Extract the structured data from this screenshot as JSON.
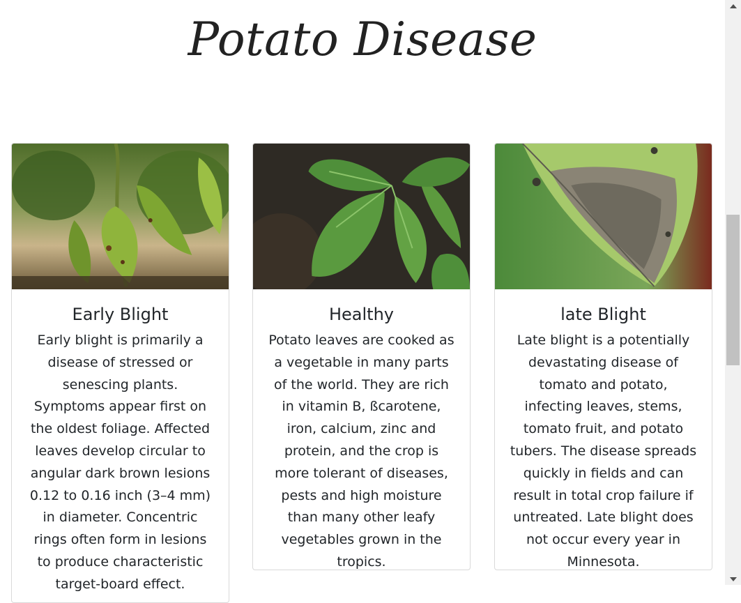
{
  "page": {
    "title": "Potato Disease"
  },
  "cards": [
    {
      "title": "Early Blight",
      "text": "Early blight is primarily a disease of stressed or senescing plants. Symptoms appear first on the oldest foliage. Affected leaves develop circular to angular dark brown lesions 0.12 to 0.16 inch (3–4 mm) in diameter. Concentric rings often form in lesions to produce characteristic target-board effect.",
      "image": "early-blight-leaves-photo"
    },
    {
      "title": "Healthy",
      "text": "Potato leaves are cooked as a vegetable in many parts of the world. They are rich in vitamin B, ßcarotene, iron, calcium, zinc and protein, and the crop is more tolerant of diseases, pests and high moisture than many other leafy vegetables grown in the tropics.",
      "image": "healthy-potato-leaves-photo"
    },
    {
      "title": "late Blight",
      "text": "Late blight is a potentially devastating disease of tomato and potato, infecting leaves, stems, tomato fruit, and potato tubers. The disease spreads quickly in fields and can result in total crop failure if untreated. Late blight does not occur every year in Minnesota.",
      "image": "late-blight-leaf-photo"
    }
  ],
  "colors": {
    "accent_green": "#5c8f3a",
    "text": "#212529",
    "border": "#dcdcdc"
  }
}
